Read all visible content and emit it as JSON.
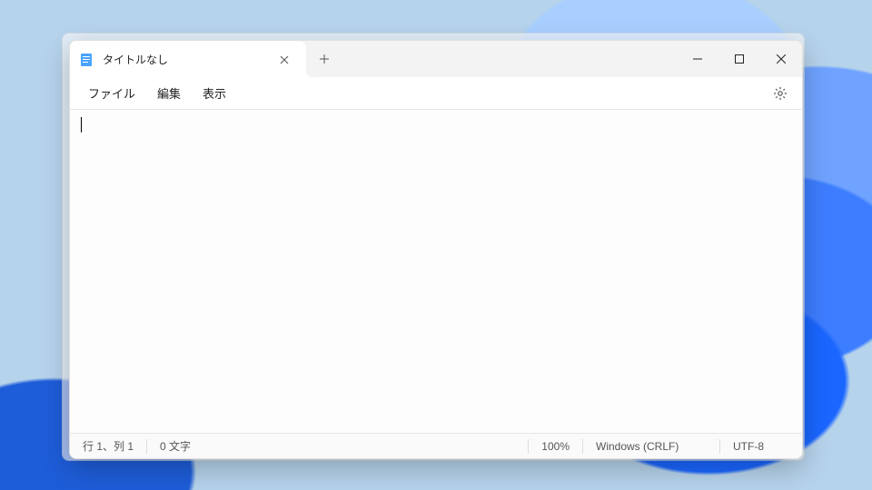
{
  "tab": {
    "title": "タイトルなし"
  },
  "menu": {
    "file": "ファイル",
    "edit": "編集",
    "view": "表示"
  },
  "editor": {
    "content": ""
  },
  "status": {
    "cursor": "行 1、列 1",
    "chars": "0 文字",
    "zoom": "100%",
    "line_ending": "Windows (CRLF)",
    "encoding": "UTF-8"
  }
}
